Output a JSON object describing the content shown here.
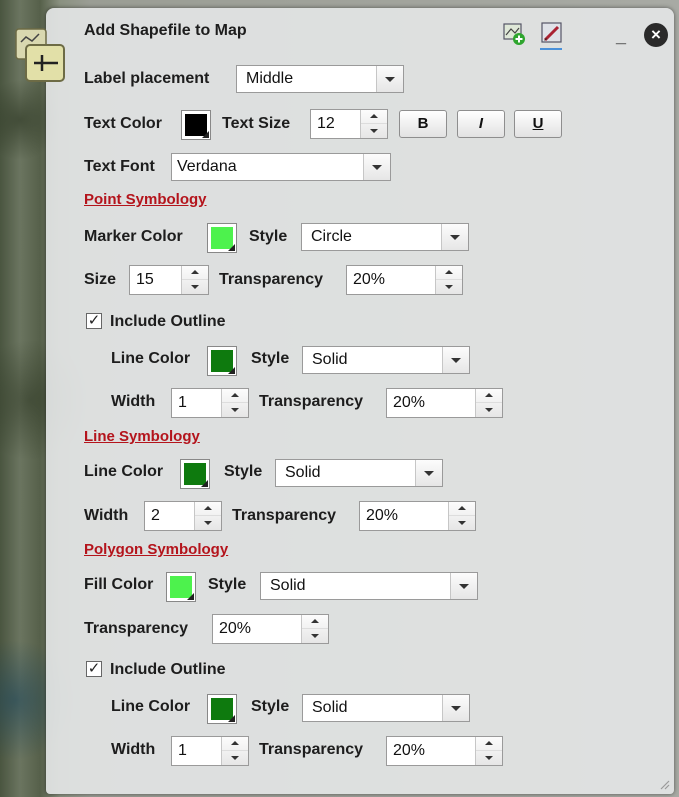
{
  "window": {
    "title": "Add Shapefile to Map"
  },
  "colors": {
    "light_green": "#4df24d",
    "dark_green": "#0e7a0e",
    "black": "#000000",
    "section_red": "#b4141c"
  },
  "icons": {
    "add": "add-layer-icon",
    "edit": "edit-layer-icon",
    "minimize": "minimize-icon",
    "close": "close-icon",
    "app": "measure-tool-icon"
  },
  "label": {
    "placement_label": "Label placement",
    "placement_value": "Middle",
    "text_color_label": "Text Color",
    "text_size_label": "Text Size",
    "text_size_value": "12",
    "bold": "B",
    "italic": "I",
    "underline": "U",
    "text_font_label": "Text Font",
    "text_font_value": "Verdana"
  },
  "point": {
    "section": "Point Symbology",
    "marker_color_label": "Marker Color",
    "style_label": "Style",
    "style_value": "Circle",
    "size_label": "Size",
    "size_value": "15",
    "transparency_label": "Transparency",
    "transparency_value": "20%",
    "include_outline": "Include Outline",
    "line_color_label": "Line Color",
    "outline_style_label": "Style",
    "outline_style_value": "Solid",
    "width_label": "Width",
    "width_value": "1",
    "outline_transparency_label": "Transparency",
    "outline_transparency_value": "20%"
  },
  "line": {
    "section": "Line Symbology",
    "line_color_label": "Line Color",
    "style_label": "Style",
    "style_value": "Solid",
    "width_label": "Width",
    "width_value": "2",
    "transparency_label": "Transparency",
    "transparency_value": "20%"
  },
  "polygon": {
    "section": "Polygon Symbology",
    "fill_color_label": "Fill Color",
    "style_label": "Style",
    "style_value": "Solid",
    "transparency_label": "Transparency",
    "transparency_value": "20%",
    "include_outline": "Include Outline",
    "line_color_label": "Line Color",
    "outline_style_label": "Style",
    "outline_style_value": "Solid",
    "width_label": "Width",
    "width_value": "1",
    "outline_transparency_label": "Transparency",
    "outline_transparency_value": "20%"
  }
}
